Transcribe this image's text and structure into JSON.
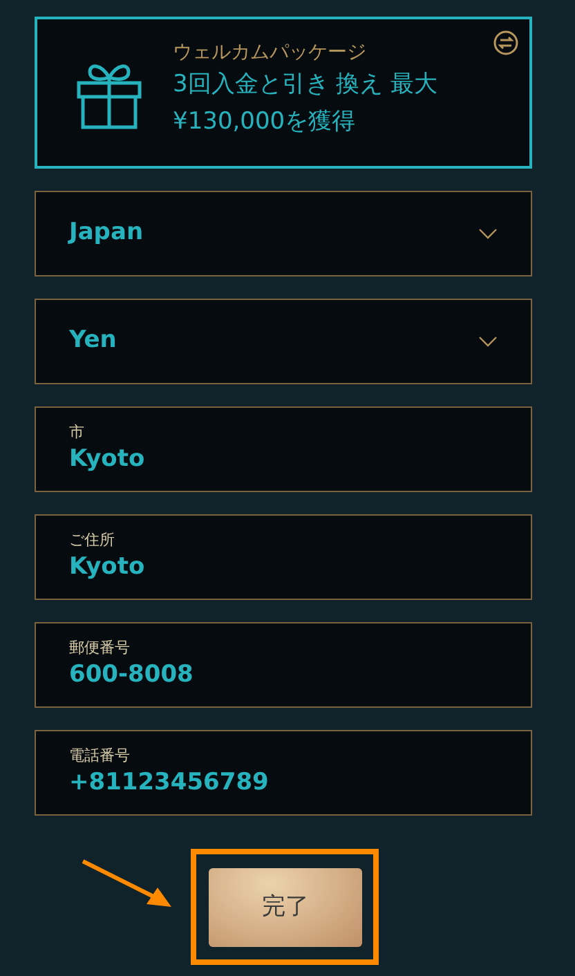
{
  "promo": {
    "title": "ウェルカムパッケージ",
    "offer": "3回入金と引き 換え 最大 ¥130,000を獲得"
  },
  "fields": [
    {
      "kind": "select",
      "value": "Japan"
    },
    {
      "kind": "select",
      "value": "Yen"
    },
    {
      "kind": "input",
      "label": "市",
      "value": "Kyoto"
    },
    {
      "kind": "input",
      "label": "ご住所",
      "value": "Kyoto"
    },
    {
      "kind": "input",
      "label": "郵便番号",
      "value": "600-8008"
    },
    {
      "kind": "input",
      "label": "電話番号",
      "value": "+81123456789"
    }
  ],
  "submit": {
    "label": "完了"
  }
}
